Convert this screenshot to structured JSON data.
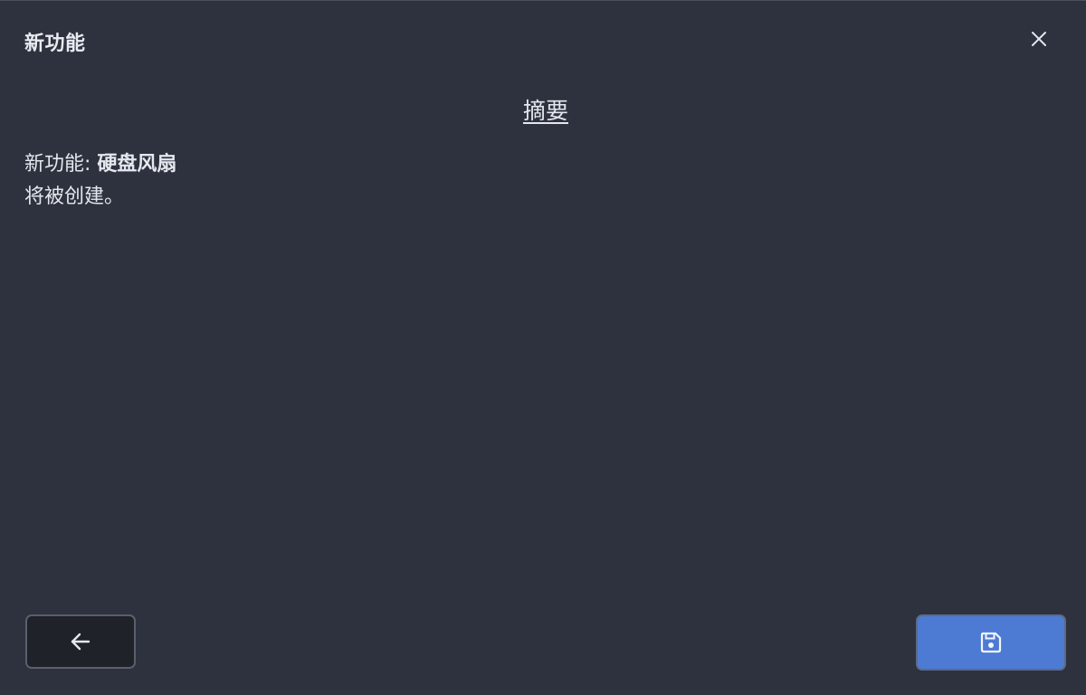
{
  "dialog": {
    "title": "新功能"
  },
  "summary": {
    "heading": "摘要",
    "label": "新功能: ",
    "feature_name": "硬盘风扇",
    "result": "将被创建。"
  },
  "actions": {
    "back_icon": "arrow-left-icon",
    "save_icon": "floppy-disk-icon",
    "close_icon": "close-icon"
  },
  "colors": {
    "background": "#2e323e",
    "save_button": "#4d7bd4",
    "back_button": "#1f2229"
  }
}
